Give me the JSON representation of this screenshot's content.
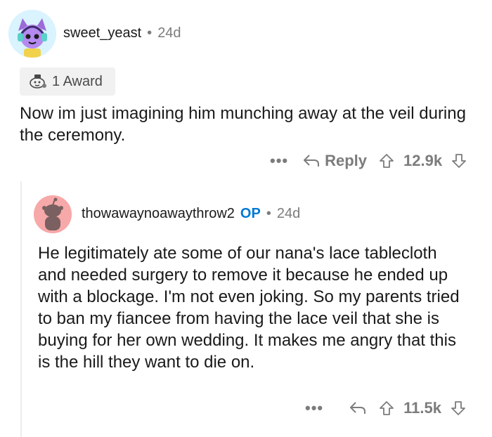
{
  "comment1": {
    "username": "sweet_yeast",
    "separator": "•",
    "age": "24d",
    "award_label": "1 Award",
    "body": "Now im just imagining him munching away at the veil during the ceremony.",
    "actions": {
      "more": "•••",
      "reply_label": "Reply",
      "upvote_count": "12.9k"
    }
  },
  "comment2": {
    "username": "thowawaynoawaythrow2",
    "op_badge": "OP",
    "separator": "•",
    "age": "24d",
    "body": "He legitimately ate some of our nana's lace tablecloth and needed surgery to remove it because he ended up with a blockage. I'm not even joking. So my parents tried to ban my fiancee from having the lace veil that she is buying for her own wedding. It makes me angry that this is the hill they want to die on.",
    "actions": {
      "more": "•••",
      "upvote_count": "11.5k"
    }
  },
  "colors": {
    "op_blue": "#0079d3",
    "meta_grey": "#7c7c7c",
    "text": "#1a1a1b",
    "award_bg": "#f1f1f1",
    "avatar2_bg": "#f7a8a8"
  }
}
